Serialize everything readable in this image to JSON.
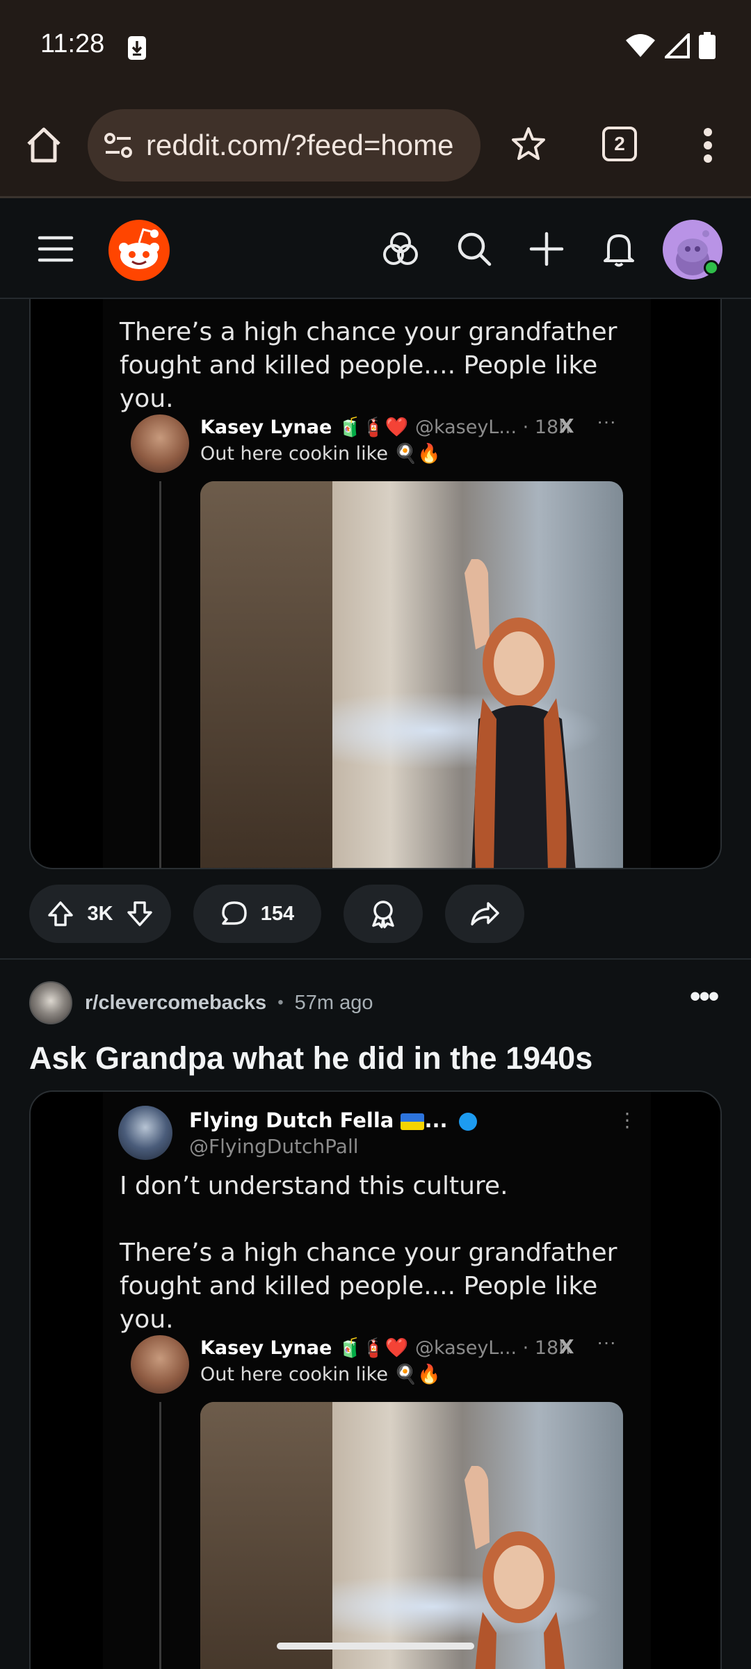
{
  "status_bar": {
    "time": "11:28",
    "icons": [
      "download-icon",
      "wifi-icon",
      "cell-signal-icon",
      "battery-icon"
    ]
  },
  "browser": {
    "url": "reddit.com/?feed=home",
    "tab_count": "2",
    "icons": [
      "home-icon",
      "site-info-icon",
      "star-icon",
      "tabs-icon",
      "more-vert-icon"
    ]
  },
  "reddit_header": {
    "icons": [
      "hamburger-icon",
      "reddit-logo",
      "popular-icon",
      "search-icon",
      "plus-icon",
      "bell-icon",
      "avatar"
    ]
  },
  "post1": {
    "screenshot": {
      "tweet_text": "There’s a high chance your grandfather fought and killed people.... People like you.",
      "quote": {
        "name": "Kasey Lynae",
        "emoji": "🧃🧯❤️",
        "handle": "@kaseyL... · 18h",
        "body": "Out here cookin like 🍳🔥"
      }
    },
    "actions": {
      "votes": "3K",
      "comments": "154"
    }
  },
  "post2": {
    "subreddit": "r/clevercomebacks",
    "age": "57m ago",
    "title": "Ask Grandpa what he did in the 1940s",
    "screenshot": {
      "author_name": "Flying Dutch Fella",
      "author_handle": "@FlyingDutchPall",
      "tweet_line1": "I don’t understand this culture.",
      "tweet_text": "There’s a high chance your grandfather fought and killed people.... People like you.",
      "quote": {
        "name": "Kasey Lynae",
        "emoji": "🧃🧯❤️",
        "handle": "@kaseyL... · 18h",
        "body": "Out here cookin like 🍳🔥"
      }
    }
  },
  "colors": {
    "chrome_bg": "#221b17",
    "page_bg": "#0e1113",
    "reddit_orange": "#ff4500",
    "pill_bg": "#1f2327"
  }
}
